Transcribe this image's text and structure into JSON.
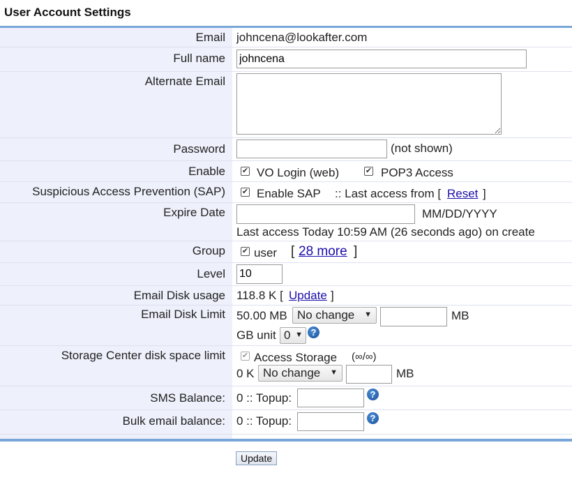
{
  "page_title": "User Account Settings",
  "email": {
    "label": "Email",
    "value": "johncena@lookafter.com"
  },
  "fullname": {
    "label": "Full name",
    "value": "johncena"
  },
  "alternate_email": {
    "label": "Alternate Email",
    "value": ""
  },
  "password": {
    "label": "Password",
    "value": "",
    "note": "(not shown)"
  },
  "enable": {
    "label": "Enable",
    "vo_login": "VO Login (web)",
    "pop3": "POP3 Access",
    "vo_checked": true,
    "pop3_checked": true
  },
  "sap": {
    "label": "Suspicious Access Prevention (SAP)",
    "enable_label": "Enable SAP",
    "last_access_text": ":: Last access from [",
    "reset_link": "Reset",
    "close_bracket": "]",
    "checked": true
  },
  "expire": {
    "label": "Expire Date",
    "value": "",
    "format": "MM/DD/YYYY",
    "last_access": "Last access Today 10:59 AM (26 seconds ago) on create"
  },
  "group": {
    "label": "Group",
    "name": "user",
    "checked": true,
    "open_bracket": "[",
    "more_link": "28 more",
    "close_bracket": "]"
  },
  "level": {
    "label": "Level",
    "value": "10"
  },
  "disk_usage": {
    "label": "Email Disk usage",
    "value": "118.8 K [",
    "update_link": "Update",
    "close_bracket": "]"
  },
  "disk_limit": {
    "label": "Email Disk Limit",
    "current": "50.00 MB",
    "select_value": "No change",
    "input_value": "",
    "unit": "MB",
    "gb_unit_label": "GB unit",
    "gb_unit_value": "0"
  },
  "storage": {
    "label": "Storage Center disk space limit",
    "access_label": "Access Storage",
    "quota": "(∞/∞)",
    "current": "0 K",
    "select_value": "No change",
    "input_value": "",
    "unit": "MB",
    "checked": true
  },
  "sms": {
    "label": "SMS Balance:",
    "value": "0 :: Topup:",
    "input_value": ""
  },
  "bulk": {
    "label": "Bulk email balance:",
    "value": "0 :: Topup:",
    "input_value": ""
  },
  "submit_label": "Update",
  "icons": {
    "help": "help-icon",
    "checkbox": "checkmark"
  },
  "colors": {
    "label_bg": "#eef0fb",
    "accent_line": "#79a6d8",
    "link": "#1a0dab"
  }
}
